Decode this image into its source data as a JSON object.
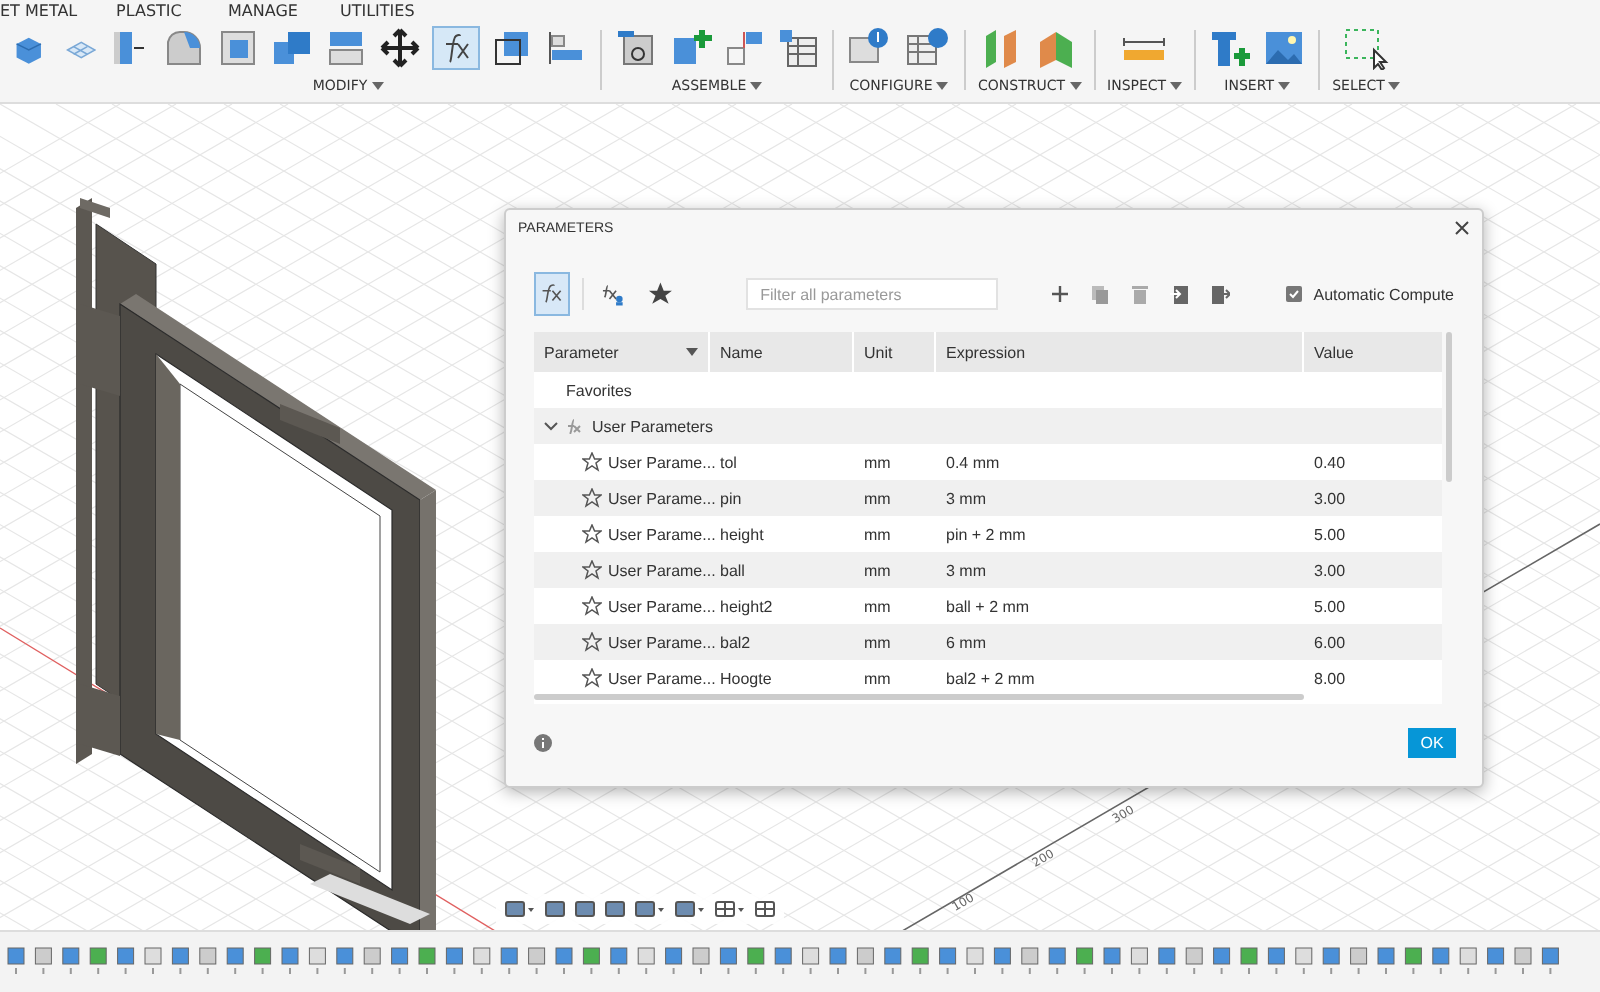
{
  "toolbar": {
    "tabs": [
      {
        "label": "ET METAL"
      },
      {
        "label": "PLASTIC"
      },
      {
        "label": "MANAGE"
      },
      {
        "label": "UTILITIES"
      }
    ],
    "groups": [
      {
        "label": "MODIFY"
      },
      {
        "label": "ASSEMBLE"
      },
      {
        "label": "CONFIGURE"
      },
      {
        "label": "CONSTRUCT"
      },
      {
        "label": "INSPECT"
      },
      {
        "label": "INSERT"
      },
      {
        "label": "SELECT"
      }
    ]
  },
  "viewport": {
    "axis_labels": [
      "300",
      "200",
      "100"
    ]
  },
  "dialog": {
    "title": "PARAMETERS",
    "filter": {
      "placeholder": "Filter all parameters"
    },
    "view_buttons": [
      {
        "kind": "all",
        "selected": true
      },
      {
        "kind": "user",
        "selected": false
      },
      {
        "kind": "favorites",
        "selected": false
      }
    ],
    "automatic_compute": {
      "label": "Automatic Compute",
      "checked": true
    },
    "columns": [
      "Parameter",
      "Name",
      "Unit",
      "Expression",
      "Value"
    ],
    "groups": [
      {
        "label": "Favorites",
        "expanded": false
      },
      {
        "label": "User Parameters",
        "expanded": true,
        "rows": [
          {
            "parameter": "User Parame...",
            "name": "tol",
            "unit": "mm",
            "expression": "0.4 mm",
            "value": "0.40",
            "favorite": false
          },
          {
            "parameter": "User Parame...",
            "name": "pin",
            "unit": "mm",
            "expression": "3 mm",
            "value": "3.00",
            "favorite": false
          },
          {
            "parameter": "User Parame...",
            "name": "height",
            "unit": "mm",
            "expression": "pin + 2 mm",
            "value": "5.00",
            "favorite": false
          },
          {
            "parameter": "User Parame...",
            "name": "ball",
            "unit": "mm",
            "expression": "3 mm",
            "value": "3.00",
            "favorite": false
          },
          {
            "parameter": "User Parame...",
            "name": "height2",
            "unit": "mm",
            "expression": "ball + 2 mm",
            "value": "5.00",
            "favorite": false
          },
          {
            "parameter": "User Parame...",
            "name": "bal2",
            "unit": "mm",
            "expression": "6 mm",
            "value": "6.00",
            "favorite": false
          },
          {
            "parameter": "User Parame...",
            "name": "Hoogte",
            "unit": "mm",
            "expression": "bal2 + 2 mm",
            "value": "8.00",
            "favorite": false
          }
        ]
      }
    ],
    "ok_button": "OK"
  }
}
